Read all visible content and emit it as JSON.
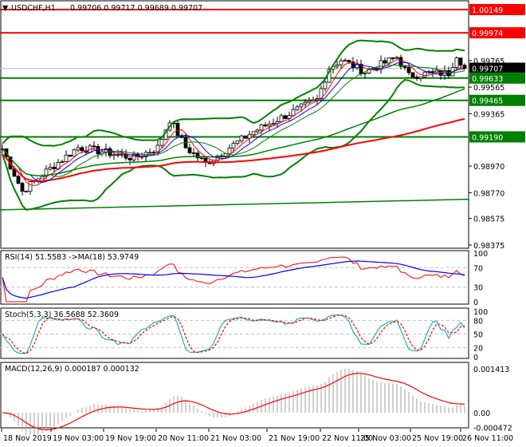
{
  "header": {
    "symbol": "USDCHF,H1",
    "ohlc": "0.99706 0.99717 0.99689 0.99707"
  },
  "chart_data": {
    "type": "candlestick",
    "title": "USDCHF,H1",
    "price_axis": {
      "min": 0.98375,
      "max": 1.00149,
      "ticks": [
        "0.99765",
        "0.99565",
        "0.99365",
        "0.98970",
        "0.98770",
        "0.98575",
        "0.98375"
      ]
    },
    "levels": [
      {
        "value": "1.00149",
        "color": "#ff0000"
      },
      {
        "value": "0.99974",
        "color": "#ff0000"
      },
      {
        "value": "0.99707",
        "color": "#000000",
        "current": true
      },
      {
        "value": "0.99633",
        "color": "#008000"
      },
      {
        "value": "0.99465",
        "color": "#008000"
      },
      {
        "value": "0.99190",
        "color": "#008000"
      }
    ],
    "trendline": {
      "from": 0.9864,
      "to": 0.9872,
      "color": "#008000"
    },
    "close_anchors": [
      [
        0,
        0.991
      ],
      [
        5,
        0.9878
      ],
      [
        11,
        0.9893
      ],
      [
        19,
        0.9911
      ],
      [
        25,
        0.9908
      ],
      [
        33,
        0.9903
      ],
      [
        39,
        0.9911
      ],
      [
        42,
        0.9932
      ],
      [
        46,
        0.9911
      ],
      [
        51,
        0.9899
      ],
      [
        57,
        0.9911
      ],
      [
        63,
        0.9923
      ],
      [
        69,
        0.9932
      ],
      [
        75,
        0.9941
      ],
      [
        79,
        0.9947
      ],
      [
        82,
        0.9971
      ],
      [
        85,
        0.9977
      ],
      [
        91,
        0.9968
      ],
      [
        99,
        0.9979
      ],
      [
        102,
        0.9965
      ],
      [
        107,
        0.9967
      ],
      [
        112,
        0.9967
      ],
      [
        114,
        0.9981
      ],
      [
        116,
        0.99707
      ]
    ],
    "candle_count": 117,
    "x_labels": [
      "18 Nov 2019",
      "19 Nov 03:00",
      "19 Nov 19:00",
      "20 Nov 11:00",
      "21 Nov 03:00",
      "21 Nov 19:00",
      "22 Nov 11:00",
      "25 Nov 03:00",
      "25 Nov 19:00",
      "26 Nov 11:00"
    ],
    "rsi": {
      "title": "RSI(14) 51.5583  ->MA(18) 53.9749",
      "ticks": [
        "100",
        "70",
        "30",
        "0"
      ]
    },
    "stoch": {
      "title": "Stoch(5,3,3) 36.5688 52.3609",
      "ticks": [
        "100",
        "80",
        "50",
        "20",
        "0"
      ]
    },
    "macd": {
      "title": "MACD(12,26,9) 0.000187 0.000132",
      "ticks": [
        "0.001413",
        "0.00",
        "-0.000472"
      ]
    }
  }
}
